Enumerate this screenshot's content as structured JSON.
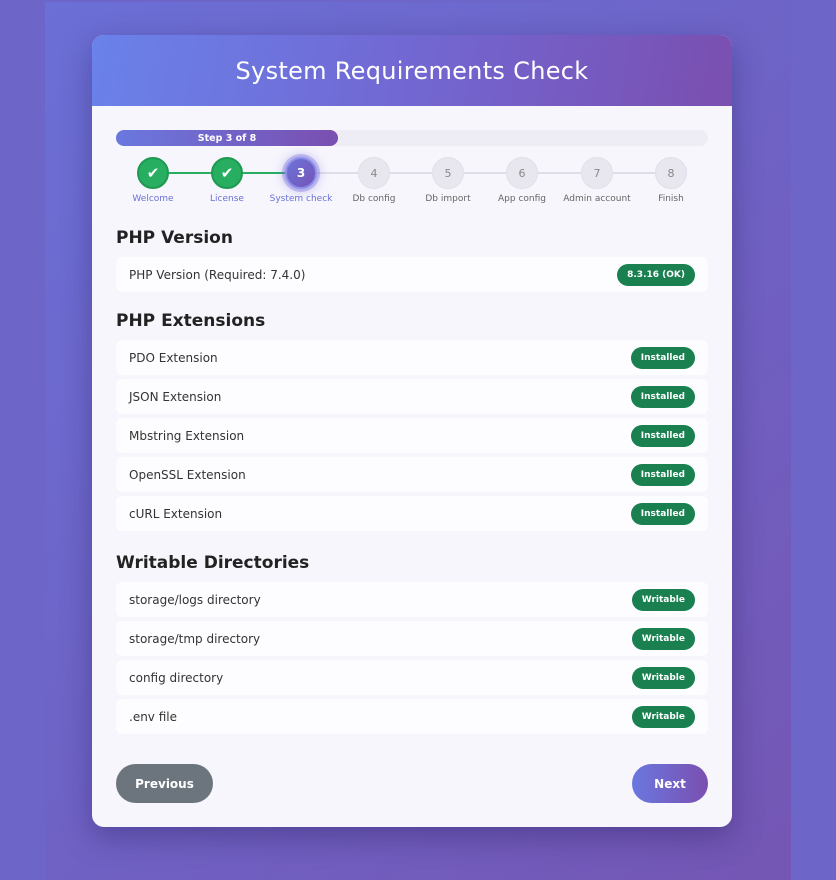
{
  "header": {
    "title": "System Requirements Check"
  },
  "progress": {
    "label": "Step 3 of 8",
    "current": 3,
    "total": 8
  },
  "steps": [
    {
      "number": "1",
      "label": "Welcome",
      "state": "done"
    },
    {
      "number": "2",
      "label": "License",
      "state": "done"
    },
    {
      "number": "3",
      "label": "System check",
      "state": "active"
    },
    {
      "number": "4",
      "label": "Db config",
      "state": "pending"
    },
    {
      "number": "5",
      "label": "Db import",
      "state": "pending"
    },
    {
      "number": "6",
      "label": "App config",
      "state": "pending"
    },
    {
      "number": "7",
      "label": "Admin account",
      "state": "pending"
    },
    {
      "number": "8",
      "label": "Finish",
      "state": "pending"
    }
  ],
  "checkmark_icon": "✔",
  "sections": {
    "php_version": {
      "title": "PHP Version",
      "items": [
        {
          "label": "PHP Version (Required: 7.4.0)",
          "status": "8.3.16 (OK)"
        }
      ]
    },
    "php_extensions": {
      "title": "PHP Extensions",
      "items": [
        {
          "label": "PDO Extension",
          "status": "Installed"
        },
        {
          "label": "JSON Extension",
          "status": "Installed"
        },
        {
          "label": "Mbstring Extension",
          "status": "Installed"
        },
        {
          "label": "OpenSSL Extension",
          "status": "Installed"
        },
        {
          "label": "cURL Extension",
          "status": "Installed"
        }
      ]
    },
    "writable_dirs": {
      "title": "Writable Directories",
      "items": [
        {
          "label": "storage/logs directory",
          "status": "Writable"
        },
        {
          "label": "storage/tmp directory",
          "status": "Writable"
        },
        {
          "label": "config directory",
          "status": "Writable"
        },
        {
          "label": ".env file",
          "status": "Writable"
        }
      ]
    }
  },
  "buttons": {
    "previous": "Previous",
    "next": "Next"
  },
  "colors": {
    "accent": "#7267d2",
    "success": "#1a8050",
    "secondary": "#6c757d"
  }
}
